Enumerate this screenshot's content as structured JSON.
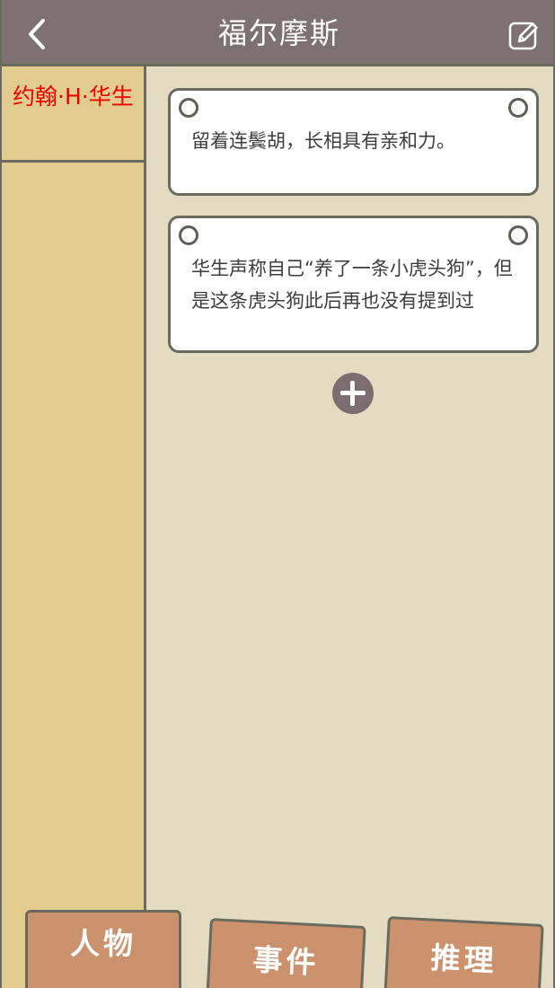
{
  "header": {
    "title": "福尔摩斯",
    "back_icon": "chevron-left-icon",
    "edit_icon": "edit-icon"
  },
  "sidebar": {
    "items": [
      {
        "label": "约翰·H·华生",
        "color": "#f20000"
      }
    ]
  },
  "notes": [
    {
      "text": "留着连鬓胡，长相具有亲和力。"
    },
    {
      "text": "华生声称自己“养了一条小虎头狗”，但是这条虎头狗此后再也没有提到过"
    }
  ],
  "add_button": {
    "icon": "plus-circle-icon"
  },
  "tabs": [
    {
      "label": "人物"
    },
    {
      "label": "事件"
    },
    {
      "label": "推理"
    }
  ],
  "colors": {
    "header_bg": "#7d7171",
    "sidebar_bg": "#e2cc8f",
    "content_bg": "#e3dcc2",
    "tab_bg": "#cc926d",
    "border": "#6b6a5f"
  }
}
